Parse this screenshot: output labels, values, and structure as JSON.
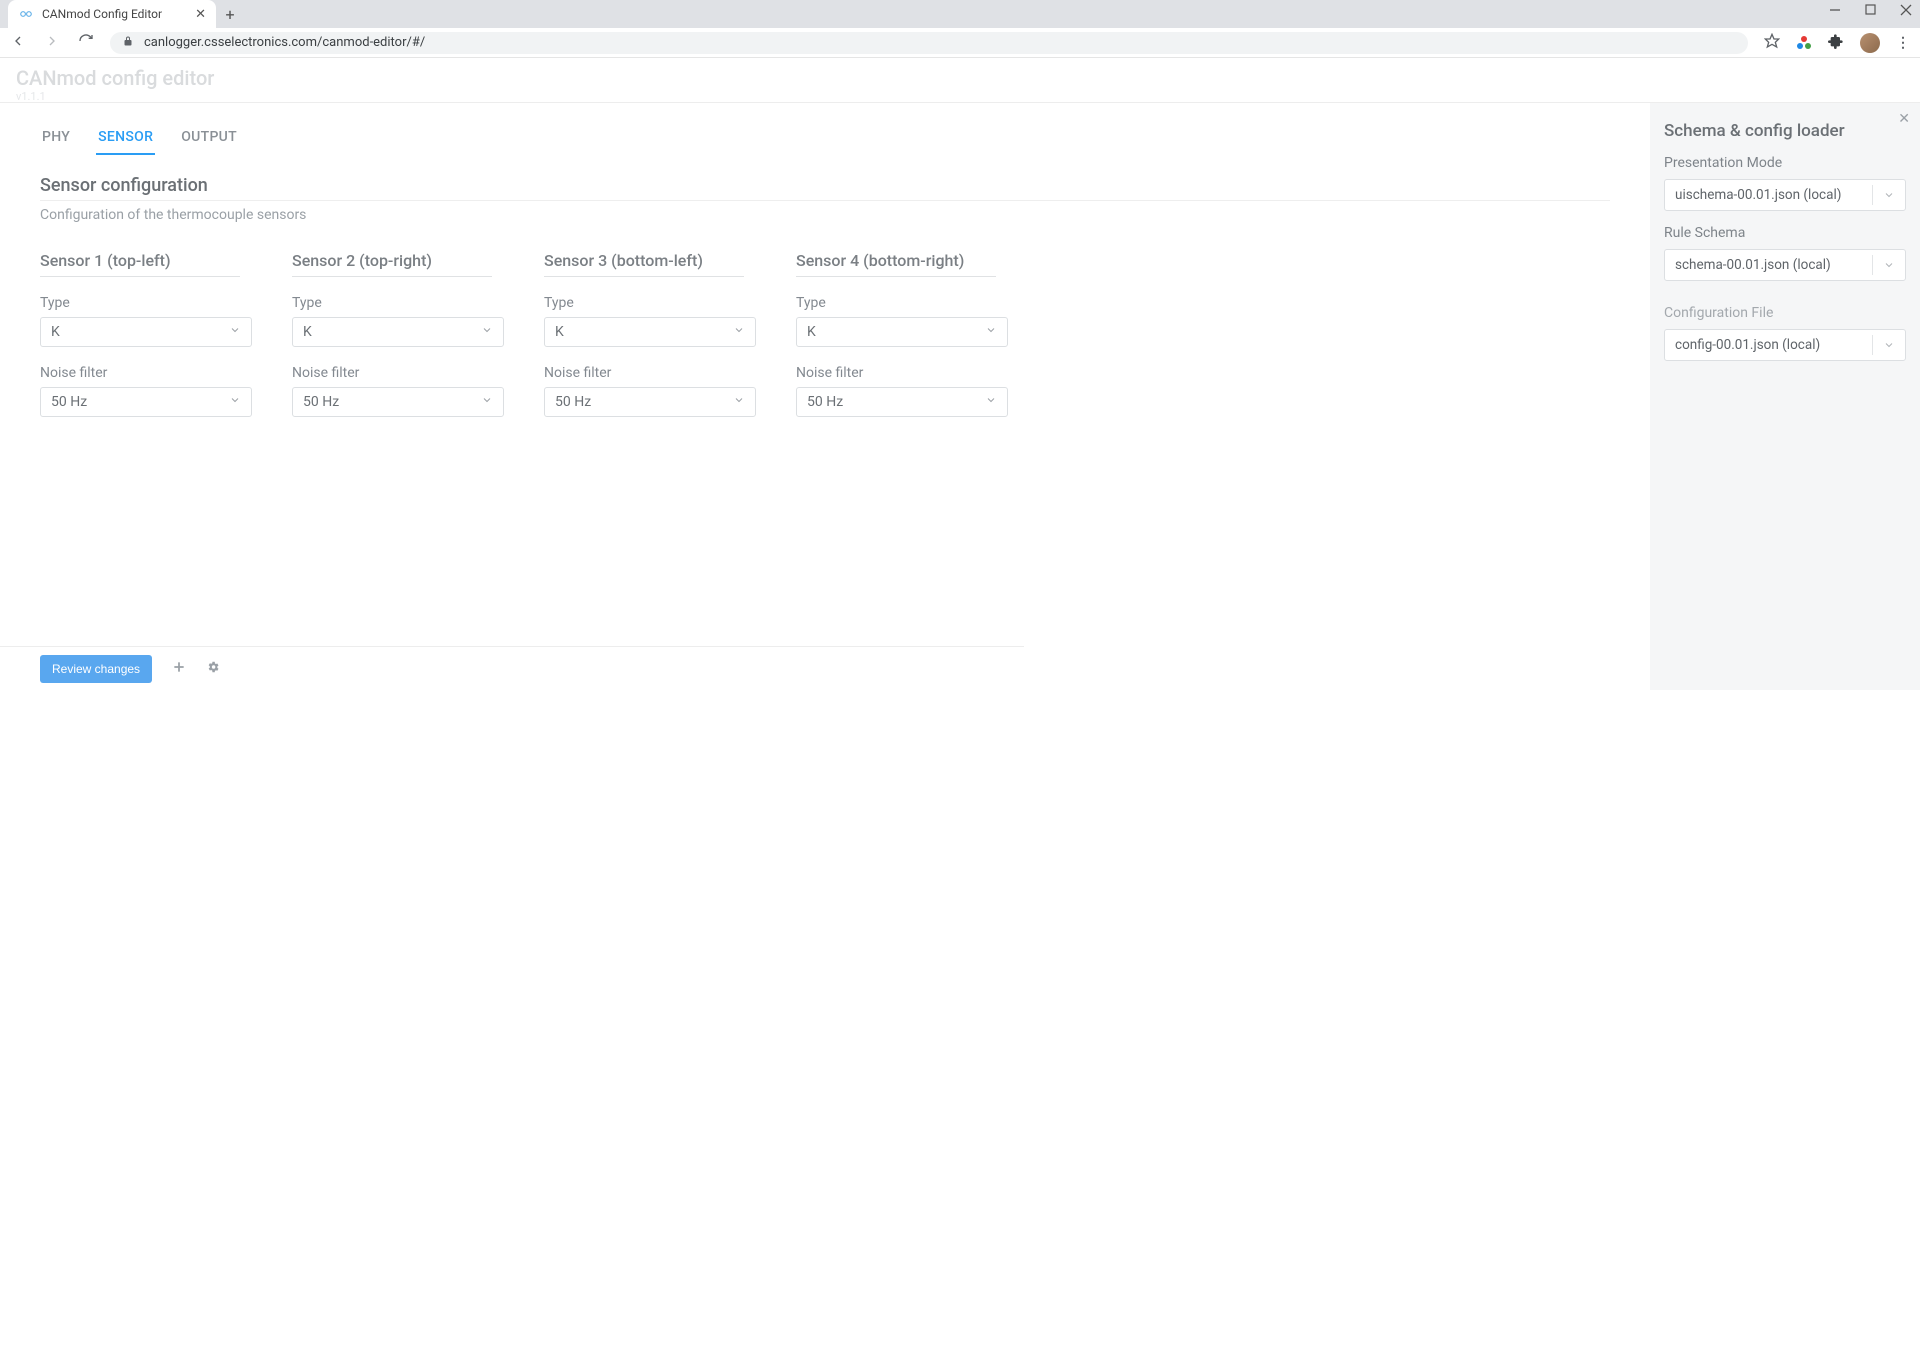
{
  "browser": {
    "tab_title": "CANmod Config Editor",
    "url": "canlogger.csselectronics.com/canmod-editor/#/"
  },
  "app": {
    "title": "CANmod config editor",
    "version": "v1.1.1"
  },
  "tabs": [
    "PHY",
    "SENSOR",
    "OUTPUT"
  ],
  "active_tab": "SENSOR",
  "section": {
    "title": "Sensor configuration",
    "subtitle": "Configuration of the thermocouple sensors"
  },
  "field_labels": {
    "type": "Type",
    "noise": "Noise filter"
  },
  "sensors": [
    {
      "name": "Sensor 1 (top-left)",
      "type": "K",
      "noise": "50 Hz"
    },
    {
      "name": "Sensor 2 (top-right)",
      "type": "K",
      "noise": "50 Hz"
    },
    {
      "name": "Sensor 3 (bottom-left)",
      "type": "K",
      "noise": "50 Hz"
    },
    {
      "name": "Sensor 4 (bottom-right)",
      "type": "K",
      "noise": "50 Hz"
    }
  ],
  "bottom": {
    "review": "Review changes"
  },
  "sidepanel": {
    "title": "Schema & config loader",
    "presentation_label": "Presentation Mode",
    "presentation_value": "uischema-00.01.json (local)",
    "rule_label": "Rule Schema",
    "rule_value": "schema-00.01.json (local)",
    "config_label": "Configuration File",
    "config_value": "config-00.01.json (local)"
  }
}
